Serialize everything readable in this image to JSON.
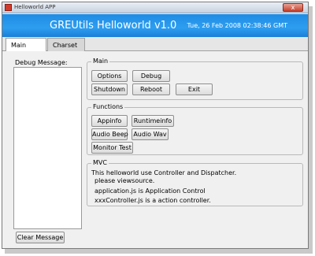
{
  "window": {
    "title": "Helloworld APP",
    "close_label": "x"
  },
  "header": {
    "app_title": "GREUtils Helloworld v1.0",
    "datetime": "Tue, 26 Feb 2008 02:38:46 GMT"
  },
  "tabs": [
    {
      "label": "Main",
      "selected": true
    },
    {
      "label": "Charset",
      "selected": false
    }
  ],
  "debug": {
    "label": "Debug Message:",
    "value": "",
    "clear_button": "Clear Message"
  },
  "groups": {
    "main": {
      "legend": "Main",
      "buttons": [
        "Options",
        "Debug",
        "Shutdown",
        "Reboot",
        "Exit"
      ]
    },
    "functions": {
      "legend": "Functions",
      "buttons": [
        "Appinfo",
        "Runtimeinfo",
        "Audio Beep",
        "Audio Wav",
        "Monitor Test"
      ]
    },
    "mvc": {
      "legend": "MVC",
      "lines": [
        "This helloworld use Controller and Dispatcher.",
        "please viewsource.",
        "application.js is Application Control",
        "xxxController.js is a action controller."
      ]
    }
  },
  "colors": {
    "header_blue": "#2d9ef0",
    "close_red": "#c6412c"
  }
}
